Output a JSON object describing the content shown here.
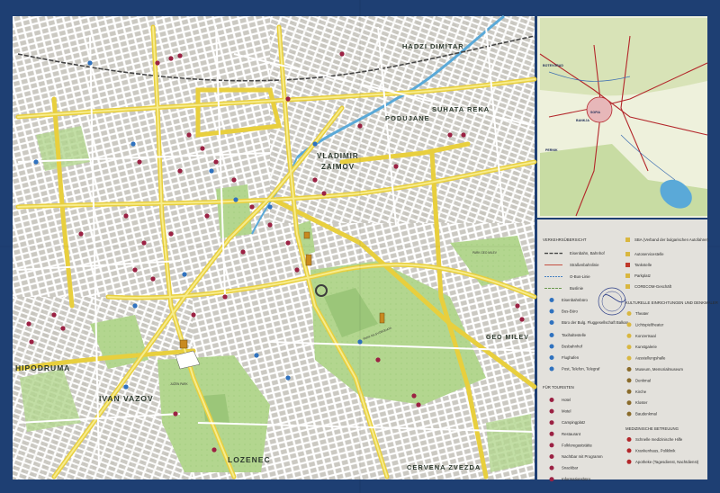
{
  "map": {
    "districts": [
      {
        "id": "hadzi-dimitar",
        "label": "HADZI  DIMITAR"
      },
      {
        "id": "podujane",
        "label": "PODUJANE"
      },
      {
        "id": "suhata-reka",
        "label": "SUHATA  REKA"
      },
      {
        "id": "vladimir-zaimov-1",
        "label": "VLADIMIR"
      },
      {
        "id": "vladimir-zaimov-2",
        "label": "ZAIMOV"
      },
      {
        "id": "geo-milev",
        "label": "GEO MILEV"
      },
      {
        "id": "hipodruma",
        "label": "HIPODRUMA"
      },
      {
        "id": "ivan-vazov",
        "label": "IVAN VAZOV"
      },
      {
        "id": "lozenec",
        "label": "LOZENEC"
      },
      {
        "id": "cervena-zvezda",
        "label": "CERVENA ZVEZDA"
      }
    ],
    "parks": [
      {
        "id": "park-na-svobodata",
        "label": "PARK NA SVOBODATA"
      },
      {
        "id": "park-geo-milev",
        "label": "PARK GEO MILEV"
      },
      {
        "id": "juzen-park",
        "label": "JUŽEN PARK"
      }
    ]
  },
  "inset": {
    "labels": [
      "SOFIA",
      "BOTEVGRAD",
      "BANKJA",
      "PERNIK"
    ]
  },
  "legend": {
    "traffic_title": "VERKEHRSÜBERSICHT",
    "traffic": [
      "Eisenbahn, Bahnhof",
      "Straßenbahnlinie",
      "O-Bus-Linie",
      "Buslinie",
      "Eisenbahnbüro",
      "Bus-Büro",
      "Büro der Bulg. Fluggesellschaft Balkan",
      "Taxihaltestelle",
      "Busbahnhof",
      "Flughafen",
      "Post, Telefon, Telegraf"
    ],
    "services": [
      "SBA (Verband der bulgarischen Autofahrer)",
      "Autoservicestelle",
      "Tankstelle",
      "Parkplatz",
      "CORECOM-Geschäft"
    ],
    "tourist_title": "FÜR TOURISTEN",
    "tourist": [
      "Hotel",
      "Motel",
      "Campingplatz",
      "Restaurant",
      "Folkloregaststätte",
      "Nachtbar mit Programm",
      "Snackbar",
      "Informationsbüro"
    ],
    "culture_title": "KULTURELLE EINRICHTUNGEN UND DENKMÄLER",
    "culture": [
      "Theater",
      "Lichtspieltheater",
      "Konzertsaal",
      "Kunstgalerie",
      "Ausstellungshalle",
      "Museum, Memorialmuseum",
      "Denkmal",
      "Kirche",
      "Kloster",
      "Baudenkmal"
    ],
    "medical_title": "MEDIZINISCHE BETREUUNG",
    "medical": [
      "Schnelle medizinische Hilfe",
      "Krankenhaus, Poliklinik",
      "Apotheke (Tagesdienst, Nachtdienst)"
    ]
  },
  "colors": {
    "paper": "#e2e0d9",
    "block": "#c9c7c0",
    "road": "#ffffff",
    "main_road": "#f4e46a",
    "park": "#b2d58e",
    "water": "#5aa9d8",
    "border": "#1e3f73",
    "dot_red": "#9b2143",
    "dot_blue": "#2f72bf"
  }
}
